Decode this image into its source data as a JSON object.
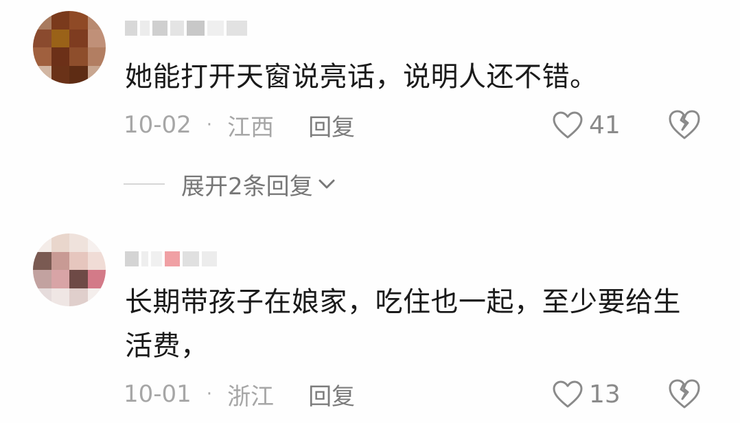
{
  "comments": [
    {
      "text": "她能打开天窗说亮话，说明人还不错。",
      "date": "10-02",
      "location": "江西",
      "reply_label": "回复",
      "likes": "41"
    },
    {
      "text": "长期带孩子在娘家，吃住也一起，至少要给生活费，",
      "date": "10-01",
      "location": "浙江",
      "reply_label": "回复",
      "likes": "13"
    }
  ],
  "expand_replies_label": "展开2条回复",
  "separator": "·",
  "icons": {
    "like": "heart-outline-icon",
    "dislike": "broken-heart-icon",
    "expand": "chevron-down-icon"
  },
  "colors": {
    "text": "#1a1a1a",
    "meta": "#a6a6a6",
    "reply": "#7c7c7c"
  }
}
